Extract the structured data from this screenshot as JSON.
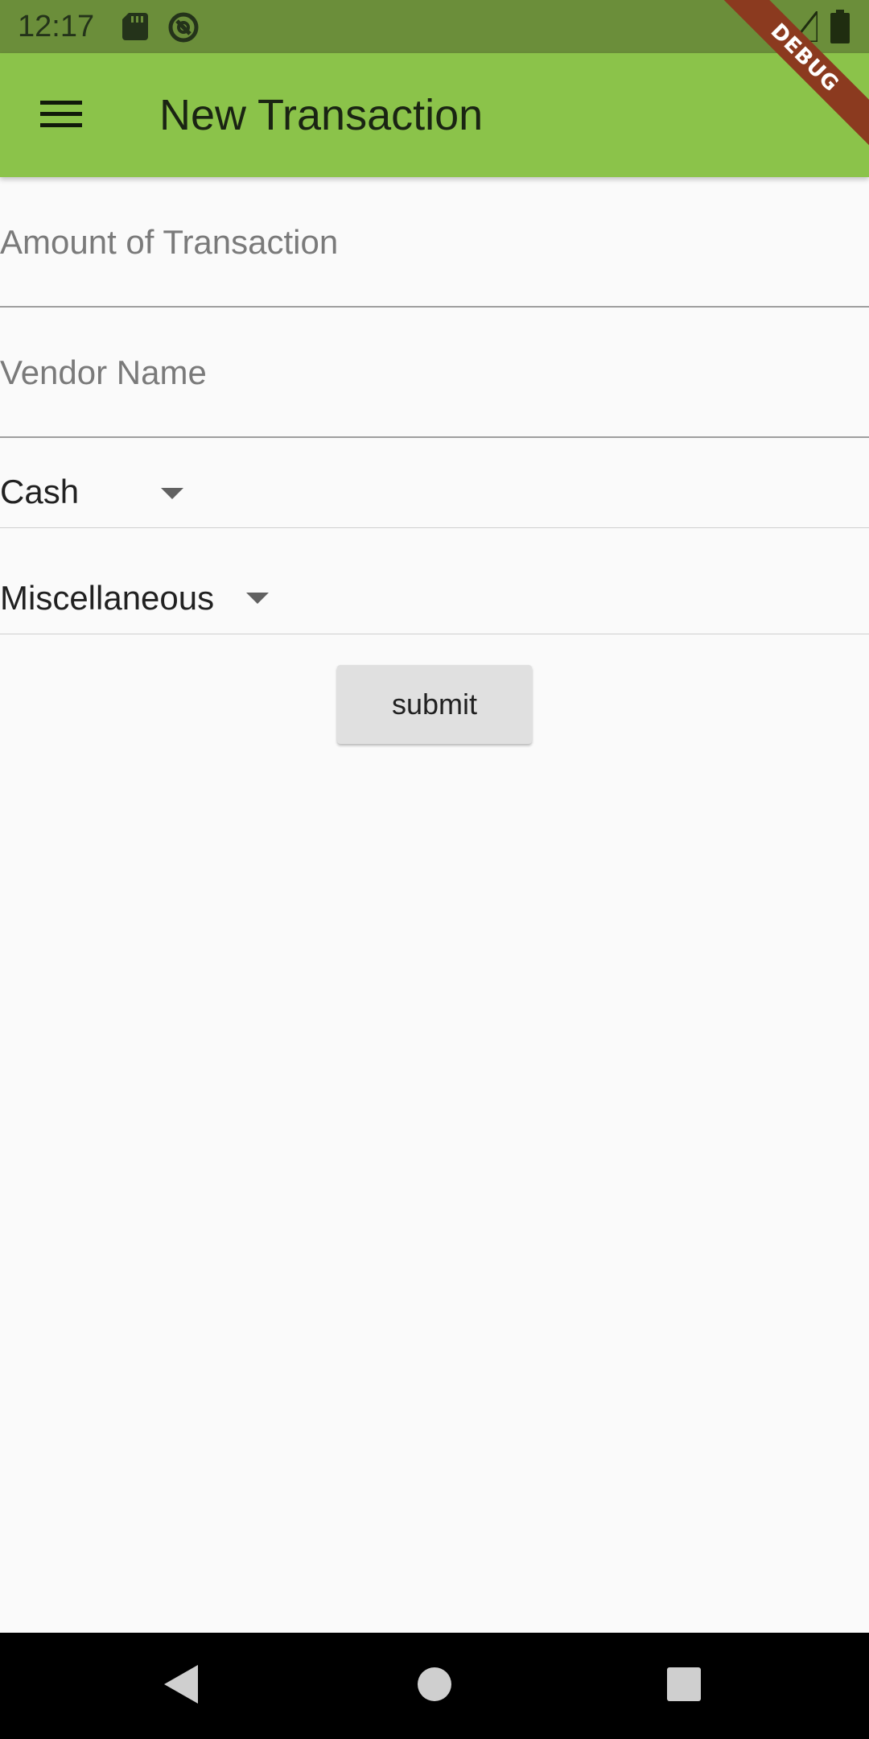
{
  "status_bar": {
    "time": "12:17",
    "icons": [
      "sd-card-icon",
      "sync-icon",
      "wifi-icon",
      "signal-icon",
      "battery-icon"
    ],
    "background": "#6b8e3a"
  },
  "app_bar": {
    "title": "New Transaction",
    "menu_icon": "menu-icon",
    "background": "#8bc34a"
  },
  "debug_banner": {
    "label": "DEBUG",
    "color": "#8b3a1f"
  },
  "form": {
    "amount": {
      "placeholder": "Amount of Transaction",
      "value": ""
    },
    "vendor": {
      "placeholder": "Vendor Name",
      "value": ""
    },
    "payment_method": {
      "selected": "Cash"
    },
    "category": {
      "selected": "Miscellaneous"
    },
    "submit_label": "submit"
  },
  "nav_bar": {
    "buttons": [
      "back-icon",
      "home-icon",
      "recents-icon"
    ]
  }
}
